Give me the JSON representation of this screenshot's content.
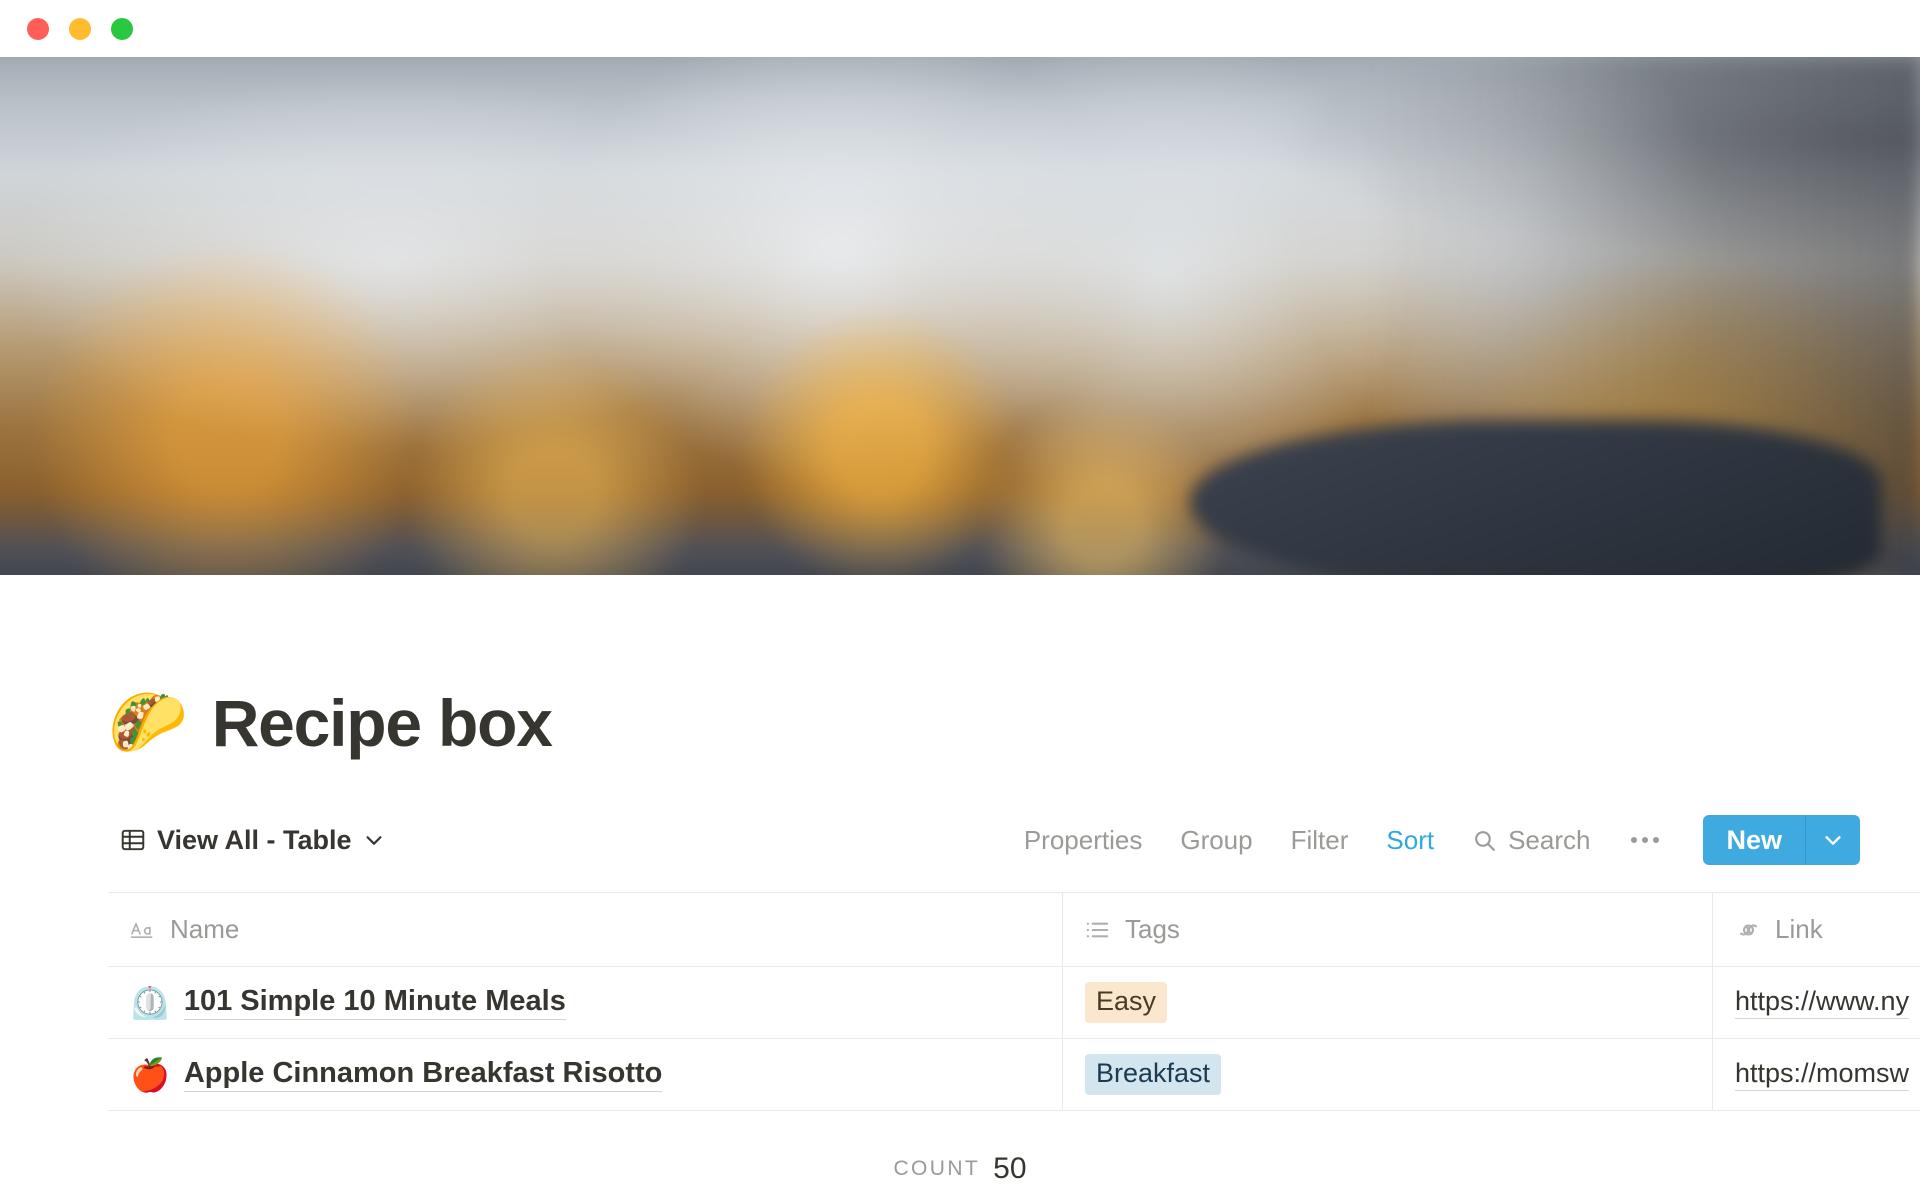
{
  "window": {
    "traffic_lights": [
      {
        "name": "close",
        "color": "#ff5f57"
      },
      {
        "name": "minimize",
        "color": "#febc2e"
      },
      {
        "name": "maximize",
        "color": "#28c840"
      }
    ]
  },
  "cover": {
    "alt": "blurred photo of wine glasses on a restaurant table"
  },
  "page": {
    "icon": "🌮",
    "title": "Recipe box"
  },
  "toolbar": {
    "view": {
      "icon": "table-icon",
      "label": "View All - Table",
      "chevron": "chevron-down-icon"
    },
    "items": [
      {
        "label": "Properties",
        "active": false
      },
      {
        "label": "Group",
        "active": false
      },
      {
        "label": "Filter",
        "active": false
      },
      {
        "label": "Sort",
        "active": true
      }
    ],
    "search": {
      "icon": "search-icon",
      "label": "Search"
    },
    "more": "•••",
    "new_button": {
      "label": "New",
      "chevron": "chevron-down-icon"
    },
    "accent_color": "#2eaadc",
    "button_color": "#3eaae0"
  },
  "table": {
    "columns": [
      {
        "key": "name",
        "label": "Name",
        "icon": "text-icon"
      },
      {
        "key": "tags",
        "label": "Tags",
        "icon": "multi-select-icon"
      },
      {
        "key": "link",
        "label": "Link",
        "icon": "url-icon"
      }
    ],
    "rows": [
      {
        "emoji": "⏲️",
        "name": "101 Simple 10 Minute Meals",
        "tag": {
          "label": "Easy",
          "bg": "#fae7cd",
          "fg": "#4a3a27"
        },
        "link": "https://www.ny"
      },
      {
        "emoji": "🍎",
        "name": "Apple Cinnamon Breakfast Risotto",
        "tag": {
          "label": "Breakfast",
          "bg": "#d3e5ef",
          "fg": "#1b3b52"
        },
        "link": "https://momsw"
      }
    ]
  },
  "footer": {
    "count_label": "Count",
    "count_value": "50"
  }
}
